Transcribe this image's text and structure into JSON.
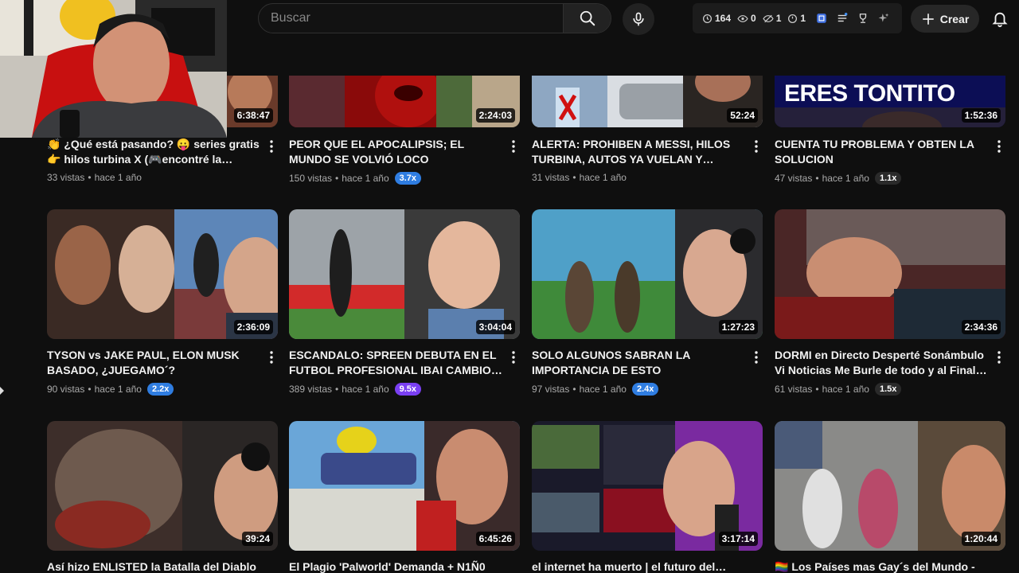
{
  "header": {
    "search_placeholder": "Buscar",
    "create_label": "Crear",
    "stats": [
      {
        "icon": "clock-icon",
        "value": "164"
      },
      {
        "icon": "eye-icon",
        "value": "0"
      },
      {
        "icon": "eye-off-icon",
        "value": "1"
      },
      {
        "icon": "clock-outline-icon",
        "value": "1"
      }
    ]
  },
  "videos": [
    {
      "title": "👏 ¿Qué está pasando? 😛 series gratis 👉 hilos turbina X (🎮encontré la adicción)",
      "views": "33 vistas",
      "age": "hace 1 año",
      "badge": "",
      "duration": "6:38:47"
    },
    {
      "title": "PEOR QUE EL APOCALIPSIS; EL MUNDO SE VOLVIÓ LOCO",
      "views": "150 vistas",
      "age": "hace 1 año",
      "badge": "3.7x",
      "badge_color": "#2f7de1",
      "duration": "2:24:03"
    },
    {
      "title": "ALERTA: PROHIBEN A MESSI, HILOS TURBINA, AUTOS YA VUELAN Y CAPAZ...",
      "views": "31 vistas",
      "age": "hace 1 año",
      "badge": "",
      "duration": "52:24"
    },
    {
      "title": "CUENTA TU PROBLEMA Y OBTEN LA SOLUCION",
      "views": "47 vistas",
      "age": "hace 1 año",
      "badge": "1.1x",
      "badge_color": "#2a2a2a",
      "duration": "1:52:36",
      "thumb_text": "ERES TONTITO"
    },
    {
      "title": "TYSON vs JAKE PAUL, ELON MUSK BASADO, ¿JUEGAMO´?",
      "views": "90 vistas",
      "age": "hace 1 año",
      "badge": "2.2x",
      "badge_color": "#2f7de1",
      "duration": "2:36:09"
    },
    {
      "title": "ESCANDALO: SPREEN DEBUTA EN EL FUTBOL PROFESIONAL IBAI CAMBIO FISIC...",
      "views": "389 vistas",
      "age": "hace 1 año",
      "badge": "9.5x",
      "badge_color": "#7a3ff2",
      "duration": "3:04:04"
    },
    {
      "title": "SOLO ALGUNOS SABRAN LA IMPORTANCIA DE ESTO",
      "views": "97 vistas",
      "age": "hace 1 año",
      "badge": "2.4x",
      "badge_color": "#2f7de1",
      "duration": "1:27:23"
    },
    {
      "title": "DORMI en Directo Desperté Sonámbulo Vi Noticias Me Burle de todo y al Final Juego...",
      "views": "61 vistas",
      "age": "hace 1 año",
      "badge": "1.5x",
      "badge_color": "#2a2a2a",
      "duration": "2:34:36"
    },
    {
      "title": "Así hizo ENLISTED la Batalla del Diablo",
      "duration": "39:24"
    },
    {
      "title": "El Plagio 'Palworld' Demanda + N1Ñ0",
      "duration": "6:45:26"
    },
    {
      "title": "el internet ha muerto | el futuro del canal",
      "duration": "3:17:14"
    },
    {
      "title": "🏳️‍🌈 Los Países mas Gay´s del Mundo -",
      "duration": "1:20:44"
    }
  ],
  "colors": {
    "background": "#0f0f0f",
    "text": "#f1f1f1",
    "meta": "#aaaaaa",
    "accent_blue": "#2f7de1",
    "accent_purple": "#7a3ff2"
  }
}
